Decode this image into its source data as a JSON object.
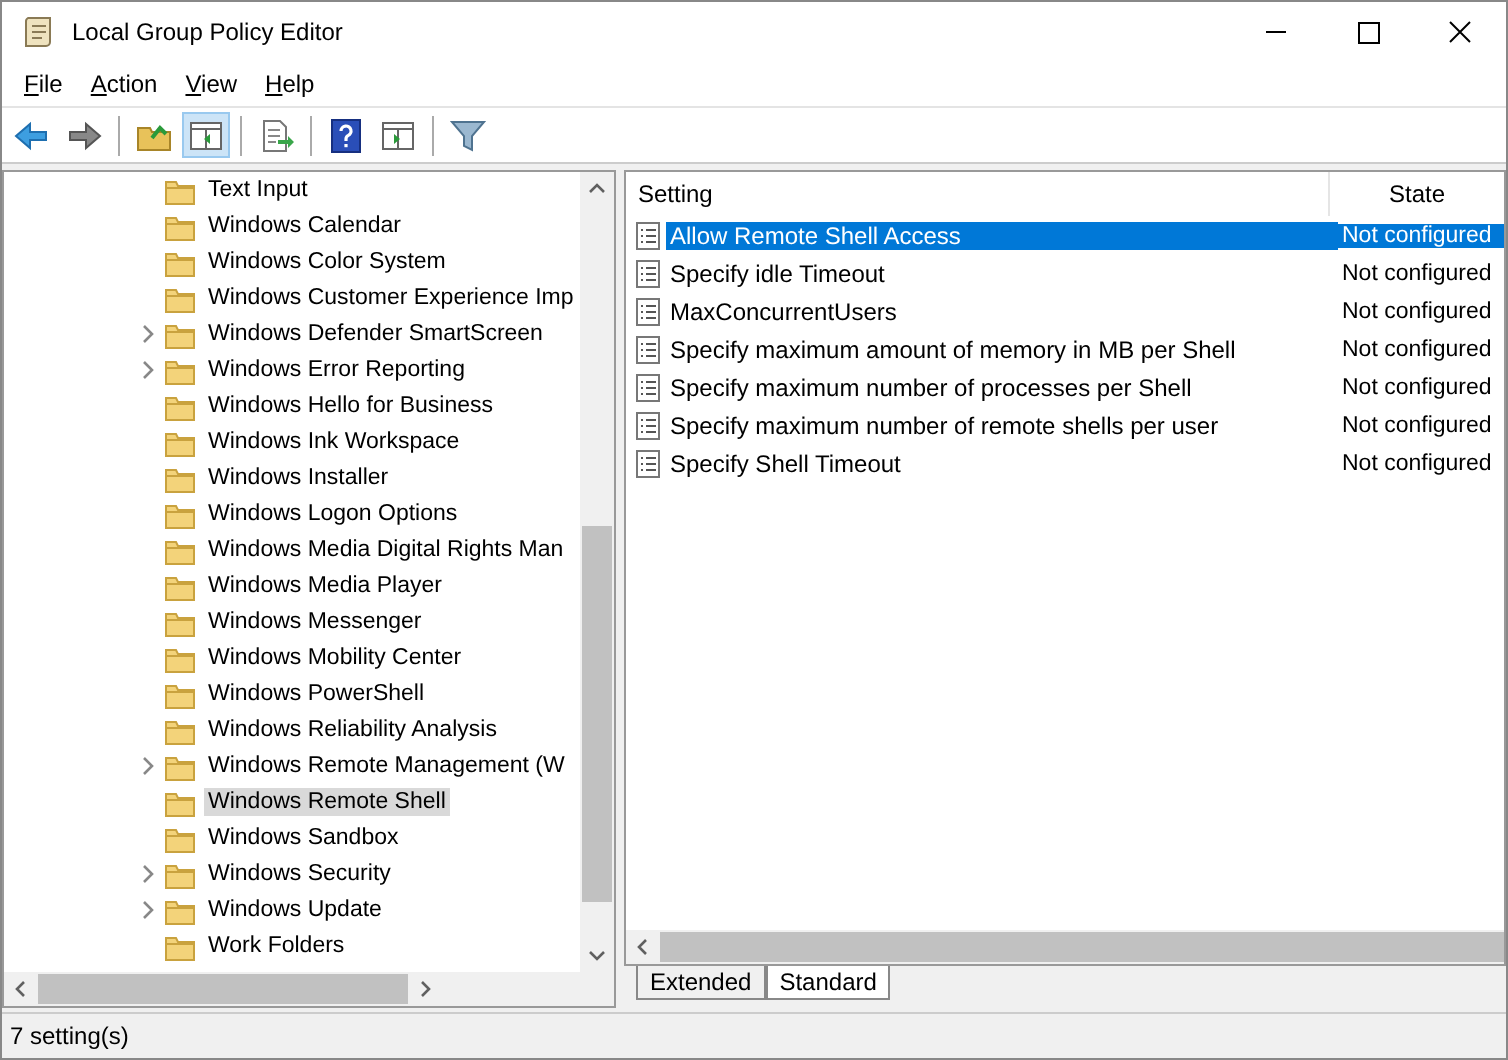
{
  "window": {
    "title": "Local Group Policy Editor"
  },
  "menu": [
    "File",
    "Action",
    "View",
    "Help"
  ],
  "toolbar": [
    {
      "kind": "back",
      "pressed": false
    },
    {
      "kind": "forward",
      "pressed": false
    },
    {
      "kind": "sep"
    },
    {
      "kind": "up",
      "pressed": false
    },
    {
      "kind": "tree",
      "pressed": true
    },
    {
      "kind": "sep"
    },
    {
      "kind": "export",
      "pressed": false
    },
    {
      "kind": "sep"
    },
    {
      "kind": "help",
      "pressed": false
    },
    {
      "kind": "panel",
      "pressed": false
    },
    {
      "kind": "sep"
    },
    {
      "kind": "filter",
      "pressed": false
    }
  ],
  "tree": [
    {
      "label": "Text Input",
      "expandable": false,
      "selected": false
    },
    {
      "label": "Windows Calendar",
      "expandable": false,
      "selected": false
    },
    {
      "label": "Windows Color System",
      "expandable": false,
      "selected": false
    },
    {
      "label": "Windows Customer Experience Imp",
      "expandable": false,
      "selected": false
    },
    {
      "label": "Windows Defender SmartScreen",
      "expandable": true,
      "selected": false
    },
    {
      "label": "Windows Error Reporting",
      "expandable": true,
      "selected": false
    },
    {
      "label": "Windows Hello for Business",
      "expandable": false,
      "selected": false
    },
    {
      "label": "Windows Ink Workspace",
      "expandable": false,
      "selected": false
    },
    {
      "label": "Windows Installer",
      "expandable": false,
      "selected": false
    },
    {
      "label": "Windows Logon Options",
      "expandable": false,
      "selected": false
    },
    {
      "label": "Windows Media Digital Rights Man",
      "expandable": false,
      "selected": false
    },
    {
      "label": "Windows Media Player",
      "expandable": false,
      "selected": false
    },
    {
      "label": "Windows Messenger",
      "expandable": false,
      "selected": false
    },
    {
      "label": "Windows Mobility Center",
      "expandable": false,
      "selected": false
    },
    {
      "label": "Windows PowerShell",
      "expandable": false,
      "selected": false
    },
    {
      "label": "Windows Reliability Analysis",
      "expandable": false,
      "selected": false
    },
    {
      "label": "Windows Remote Management (W",
      "expandable": true,
      "selected": false
    },
    {
      "label": "Windows Remote Shell",
      "expandable": false,
      "selected": true
    },
    {
      "label": "Windows Sandbox",
      "expandable": false,
      "selected": false
    },
    {
      "label": "Windows Security",
      "expandable": true,
      "selected": false
    },
    {
      "label": "Windows Update",
      "expandable": true,
      "selected": false
    },
    {
      "label": "Work Folders",
      "expandable": false,
      "selected": false
    }
  ],
  "table": {
    "columns": [
      "Setting",
      "State"
    ],
    "rows": [
      {
        "setting": "Allow Remote Shell Access",
        "state": "Not configured",
        "selected": true
      },
      {
        "setting": "Specify idle Timeout",
        "state": "Not configured",
        "selected": false
      },
      {
        "setting": "MaxConcurrentUsers",
        "state": "Not configured",
        "selected": false
      },
      {
        "setting": "Specify maximum amount of memory in MB per Shell",
        "state": "Not configured",
        "selected": false
      },
      {
        "setting": "Specify maximum number of processes per Shell",
        "state": "Not configured",
        "selected": false
      },
      {
        "setting": "Specify maximum number of remote shells per user",
        "state": "Not configured",
        "selected": false
      },
      {
        "setting": "Specify Shell Timeout",
        "state": "Not configured",
        "selected": false
      }
    ]
  },
  "tabs": [
    {
      "label": "Extended",
      "selected": false
    },
    {
      "label": "Standard",
      "selected": true
    }
  ],
  "status_bar": "7 setting(s)"
}
